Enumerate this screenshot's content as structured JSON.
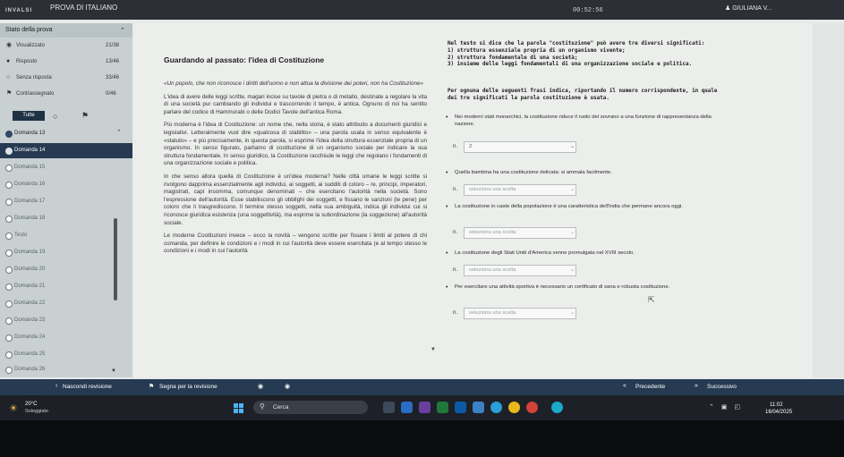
{
  "topbar": {
    "brand": "INVALSI",
    "exam_title": "PROVA DI ITALIANO",
    "timer": "00:52:56",
    "user": "GIULIANA V..."
  },
  "sidebar": {
    "heading": "Stato della prova",
    "stats": [
      {
        "label": "Visualizzato",
        "count": "21/38",
        "icon": "eye-icon"
      },
      {
        "label": "Risposto",
        "count": "13/46",
        "icon": "dot-icon"
      },
      {
        "label": "Senza risposta",
        "count": "33/46",
        "icon": "circle-icon"
      },
      {
        "label": "Contrassegnato",
        "count": "0/46",
        "icon": "flag-icon"
      }
    ],
    "filter_all": "Tutte",
    "domanda_13": "Domanda 13",
    "items": [
      "Domanda 14",
      "Domanda 15",
      "Domanda 16",
      "Domanda 17",
      "Domanda 18",
      "Testo",
      "Domanda 19",
      "Domanda 20",
      "Domanda 21",
      "Domanda 22",
      "Domanda 23",
      "Domanda 24",
      "Domanda 25",
      "Domanda 26"
    ]
  },
  "main": {
    "passage_title": "Guardando al passato: l'idea di Costituzione",
    "paragraphs": [
      "«Un popolo, che non riconosce i diritti dell'uomo e non attua la divisione dei poteri, non ha Costituzione»",
      "L'idea di avere delle leggi scritte, magari incise su tavole di pietra o di metallo, destinate a regolare la vita di una società pur cambiando gli individui e trascorrendo il tempo, è antica. Ognuno di noi ha sentito parlare del codice di Hammurabi o delle Dodici Tavole dell'antica Roma.",
      "Più moderna è l'idea di Costituzione: un nome che, nella storia, è stato attribuito a documenti giuridici e legislativi. Letteralmente vuol dire «qualcosa di stabilito» – una parola usata in senso equivalente è «statuto» – e più precisamente, in questa parola, si esprime l'idea della struttura essenziale propria di un organismo. In senso figurato, parliamo di costituzione di un organismo sociale per indicare la sua struttura fondamentale. In senso giuridico, la Costituzione racchiude le leggi che regolano i fondamenti di una organizzazione sociale e politica.",
      "In che senso allora quella di Costituzione è un'idea moderna? Nelle città umane le leggi scritte si rivolgono dapprima essenzialmente agli individui, ai soggetti, ai sudditi di coloro – re, principi, imperatori, magistrati, capi insomma, comunque denominati – che esercitano l'autorità nella società. Sono l'espressione dell'autorità. Esse stabiliscono gli obblighi dei soggetti, e fissano le sanzioni (le pene) per coloro che li trasgrediscono. Il termine stesso soggetti, nella sua ambiguità, indica gli individui cui si riconosce giuridica esistenza (una soggettività), ma esprime la subordinazione (la soggezione) all'autorità sociale.",
      "Le moderne Costituzioni invece – ecco la novità – vengono scritte per fissare i limiti al potere di chi comanda, per definire le condizioni e i modi in cui l'autorità deve essere esercitata (e al tempo stesso le condizioni e i modi in cui l'autorità"
    ],
    "q_intro": [
      "Nel testo si dice che la parola \"costituzione\" può avere tre diversi significati:",
      "1) struttura essenziale propria di un organismo vivente;",
      "2) struttura fondamentale di una società;",
      "3) insieme delle leggi fondamentali di una organizzazione sociale e politica."
    ],
    "instruction": "Per ognuna delle seguenti frasi indica, riportando il numero corrispondente, in quale dei tre significati la parola costituzione è usata.",
    "n_label": "n.",
    "items": [
      {
        "text": "Nei moderni stati monarchici, la costituzione riduce il ruolo del sovrano a una funzione di rappresentanza della nazione.",
        "answer": "2"
      },
      {
        "text": "Quella bambina ha una costituzione delicata: si ammala facilmente.",
        "answer": "seleziona una scelta"
      },
      {
        "text": "La costituzione in caste della popolazione è una caratteristica dell'India che permane ancora oggi.",
        "answer": "seleziona una scelta"
      },
      {
        "text": "La costituzione degli Stati Uniti d'America venne promulgata nel XVIII secolo.",
        "answer": "seleziona una scelta"
      },
      {
        "text": "Per esercitare una attività sportiva è necessario un certificato di sana e robusta costituzione.",
        "answer": "seleziona una scelta"
      }
    ]
  },
  "navbar": {
    "review": "Nascondi revisione",
    "flag": "Segna per la revisione",
    "prev": "Precedente",
    "next": "Successivo"
  },
  "taskbar": {
    "temp": "20°C",
    "condition": "Soleggiato",
    "search": "Cerca",
    "time": "11:02",
    "date": "16/04/2025"
  }
}
